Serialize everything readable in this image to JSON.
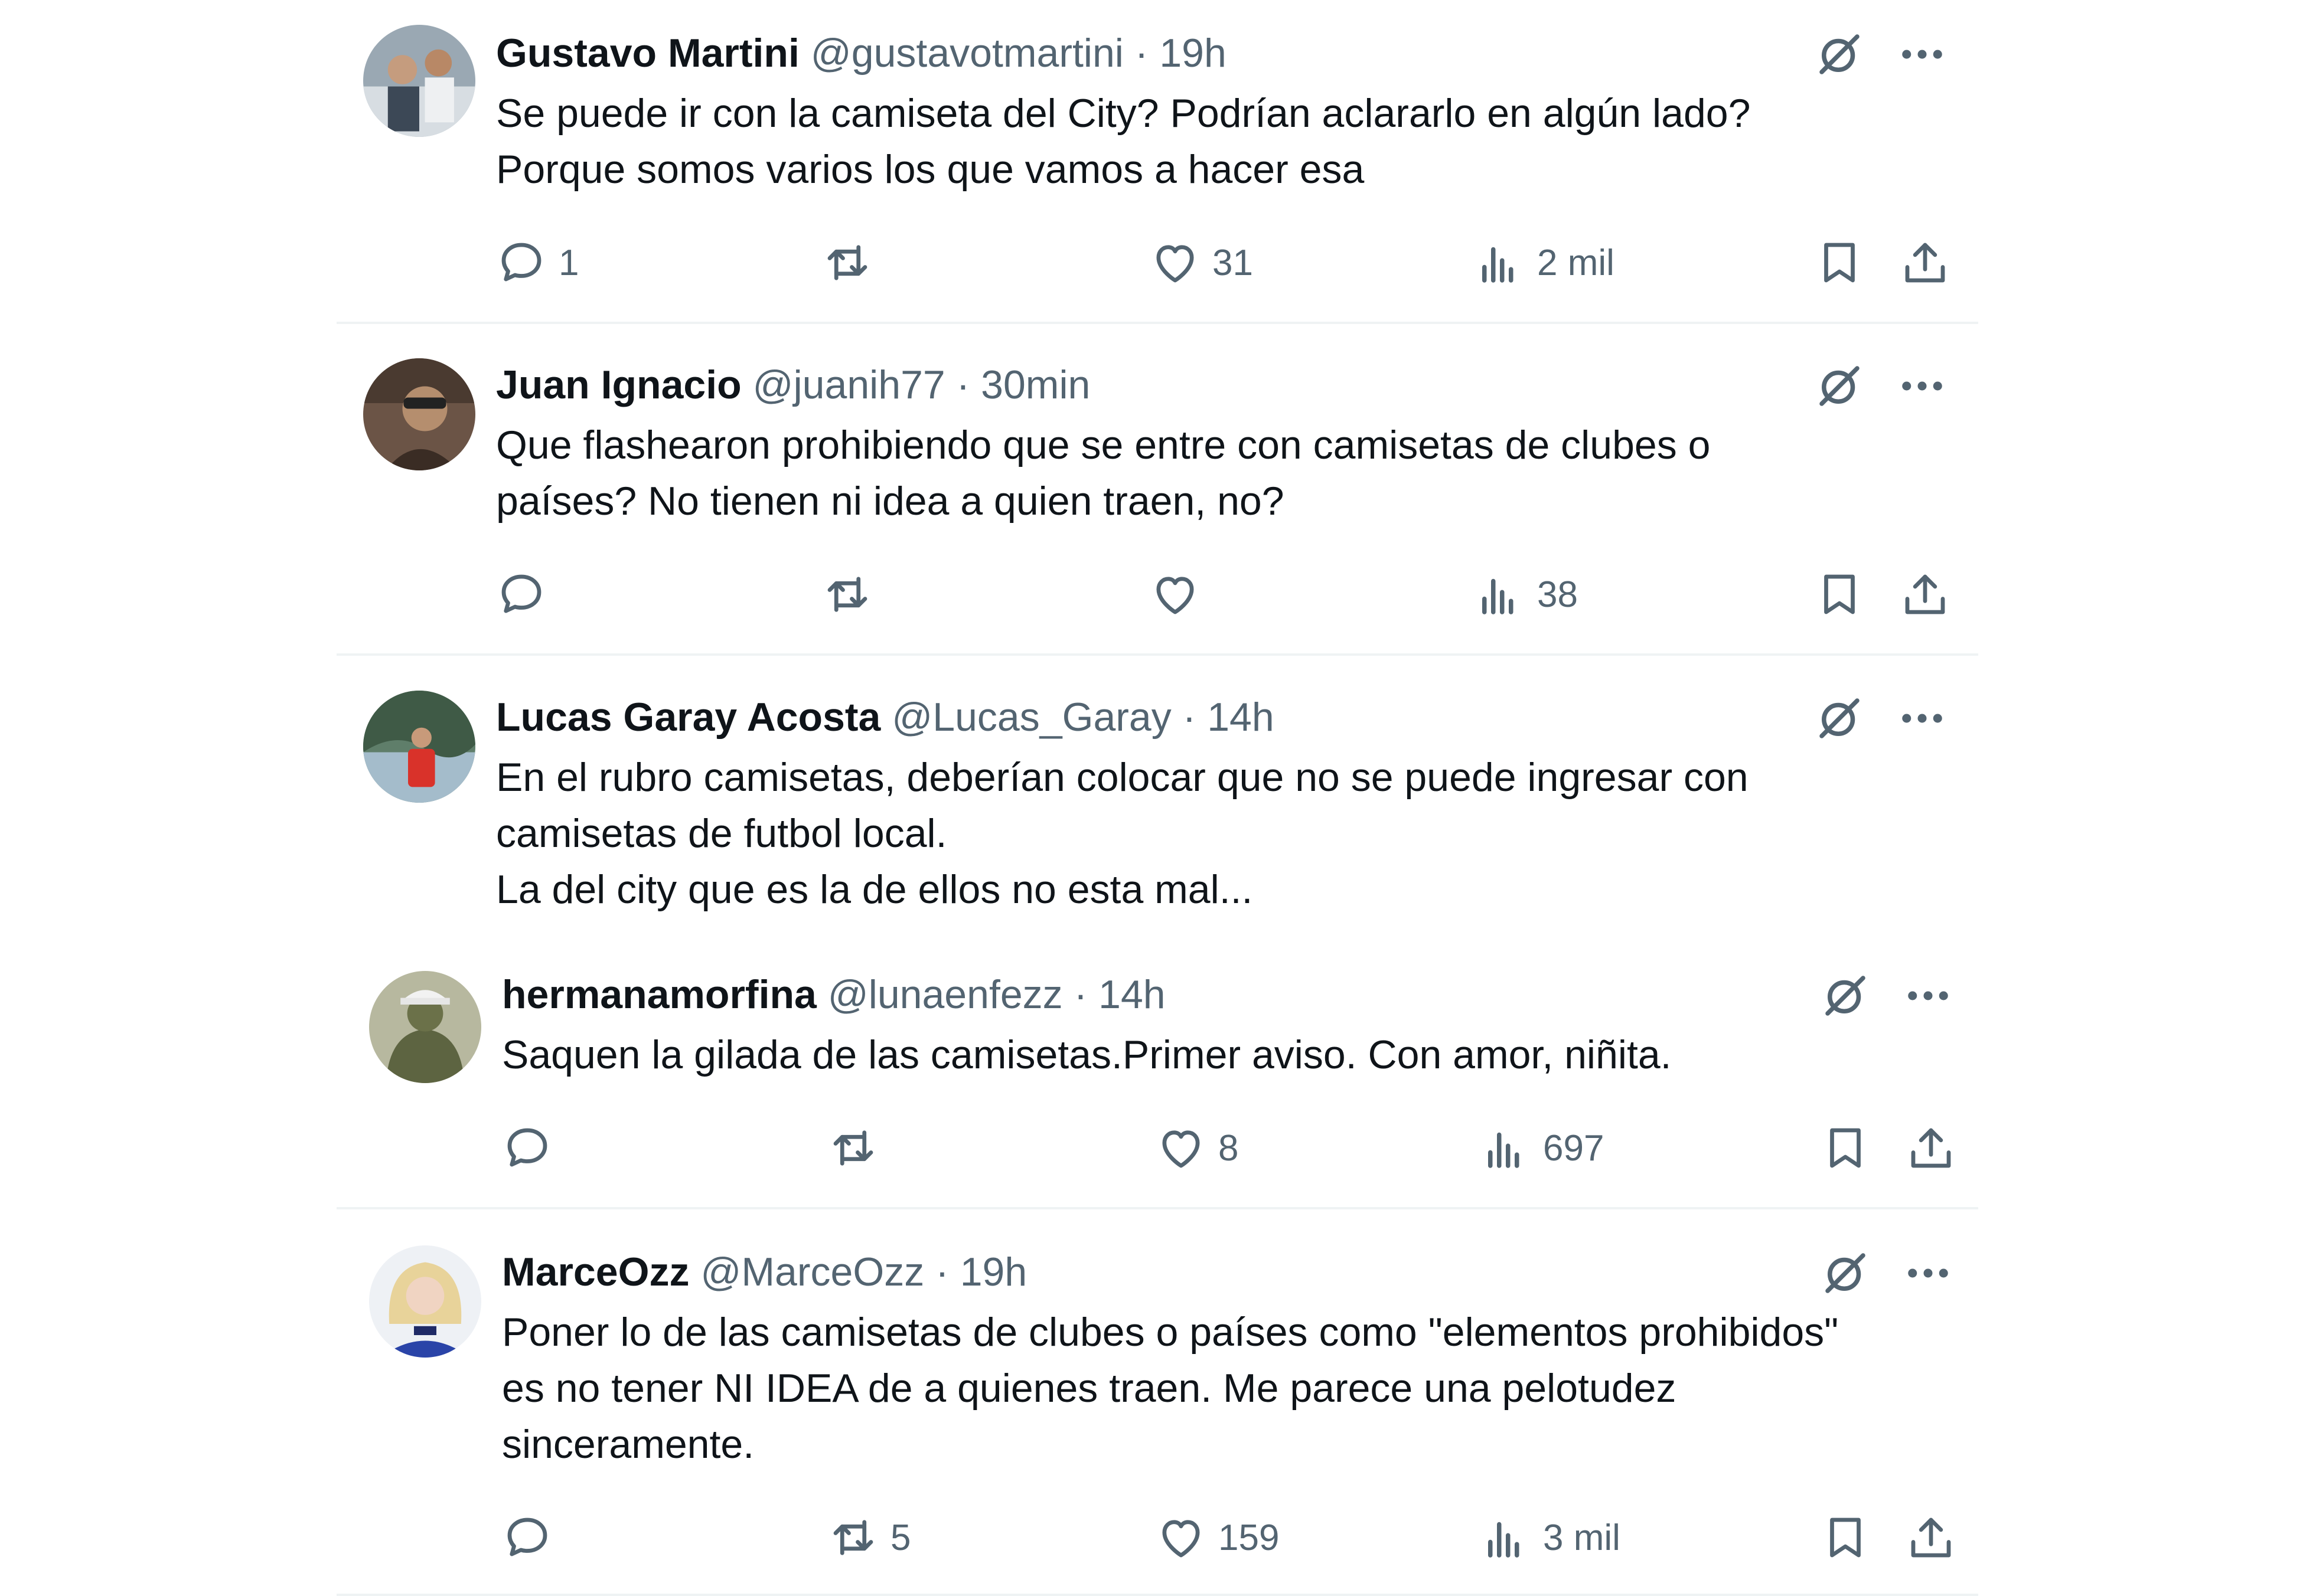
{
  "tweets": [
    {
      "name": "Gustavo Martini",
      "handle": "@gustavotmartini",
      "separator": "·",
      "time": "19h",
      "text": "Se puede ir con la camiseta del City? Podrían aclararlo en algún lado?\nPorque somos varios los que vamos a hacer esa",
      "replies": "1",
      "retweets": "",
      "likes": "31",
      "views": "2 mil"
    },
    {
      "name": "Juan Ignacio",
      "handle": "@juanih77",
      "separator": "·",
      "time": "30min",
      "text": "Que flashearon prohibiendo que se entre con camisetas de clubes o\npaíses? No tienen ni idea a quien traen, no?",
      "replies": "",
      "retweets": "",
      "likes": "",
      "views": "38"
    },
    {
      "name": "Lucas Garay Acosta",
      "handle": "@Lucas_Garay",
      "separator": "·",
      "time": "14h",
      "text": "En el rubro camisetas, deberían colocar que no se puede ingresar con\ncamisetas de futbol local.\nLa del city que es la de ellos no esta mal..."
    },
    {
      "name": "hermanamorfina",
      "handle": "@lunaenfezz",
      "separator": "·",
      "time": "14h",
      "text": "Saquen la gilada de las camisetas.Primer aviso. Con amor, niñita.",
      "replies": "",
      "retweets": "",
      "likes": "8",
      "views": "697"
    },
    {
      "name": "MarceOzz",
      "handle": "@MarceOzz",
      "separator": "·",
      "time": "19h",
      "text": "Poner lo de las camisetas de clubes o países como \"elementos prohibidos\"\nes no tener NI IDEA de a quienes traen. Me parece una pelotudez\nsinceramente.",
      "replies": "",
      "retweets": "5",
      "likes": "159",
      "views": "3 mil"
    }
  ],
  "icons": {
    "grok": "grok-icon",
    "more": "more-icon",
    "reply": "reply-icon",
    "retweet": "retweet-icon",
    "like": "like-icon",
    "views": "views-icon",
    "bookmark": "bookmark-icon",
    "share": "share-icon"
  },
  "colors": {
    "text": "#0f1419",
    "secondary": "#536471",
    "divider": "#eff3f4"
  }
}
